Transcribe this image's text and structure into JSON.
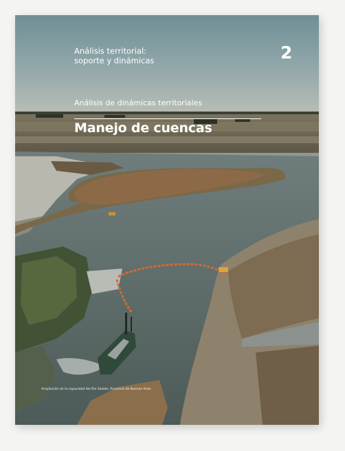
{
  "header": {
    "chapter_label_line1": "Análisis territorial:",
    "chapter_label_line2": "soporte y dinámicas",
    "chapter_number": "2"
  },
  "section": {
    "label": "Análisis de dinámicas territoriales",
    "title": "Manejo de cuencas"
  },
  "photo": {
    "caption": "Ampliación de la capacidad del Río Salado, Provincia de Buenos Aires"
  }
}
